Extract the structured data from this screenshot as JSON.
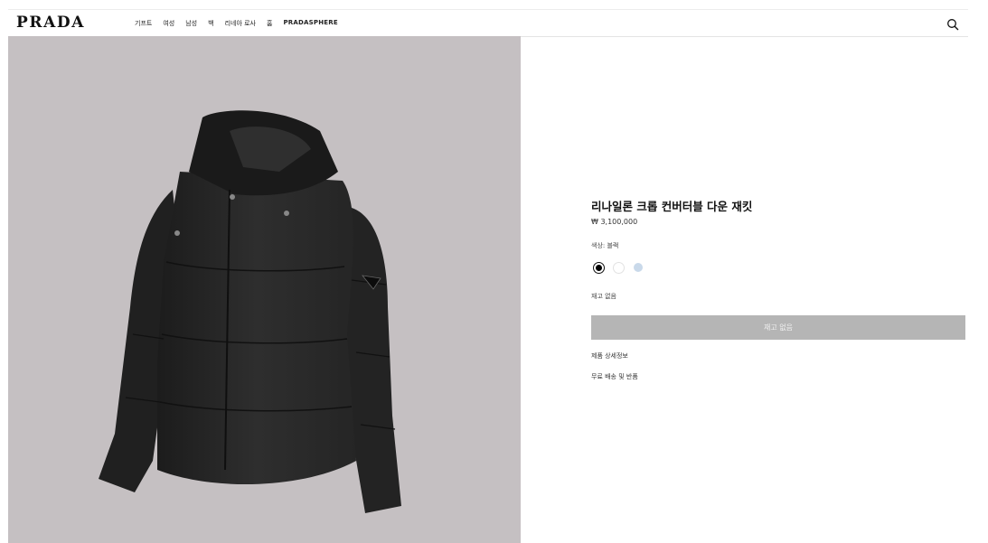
{
  "header": {
    "logo": "PRADA",
    "nav": [
      "기프트",
      "여성",
      "남성",
      "백",
      "리네아 로사",
      "홈",
      "PRADASPHERE"
    ],
    "search_icon": "search-icon"
  },
  "product": {
    "title": "리나일론 크롭 컨버터블 다운 재킷",
    "price": "₩ 3,100,000",
    "color_label": "색상: 블랙",
    "swatches": [
      {
        "name": "black",
        "color": "#000000",
        "selected": true
      },
      {
        "name": "white",
        "color": "#ffffff",
        "selected": false
      },
      {
        "name": "light-blue",
        "color": "#c9d9ea",
        "selected": false
      }
    ],
    "stock_status": "재고 없음",
    "buy_button": "재고 없음",
    "details_link": "제품 상세정보",
    "shipping_link": "무료 배송 및 반품"
  },
  "colors": {
    "image_background": "#c5c0c2",
    "button_disabled": "#b5b5b5",
    "jacket": "#2a2a2a"
  }
}
